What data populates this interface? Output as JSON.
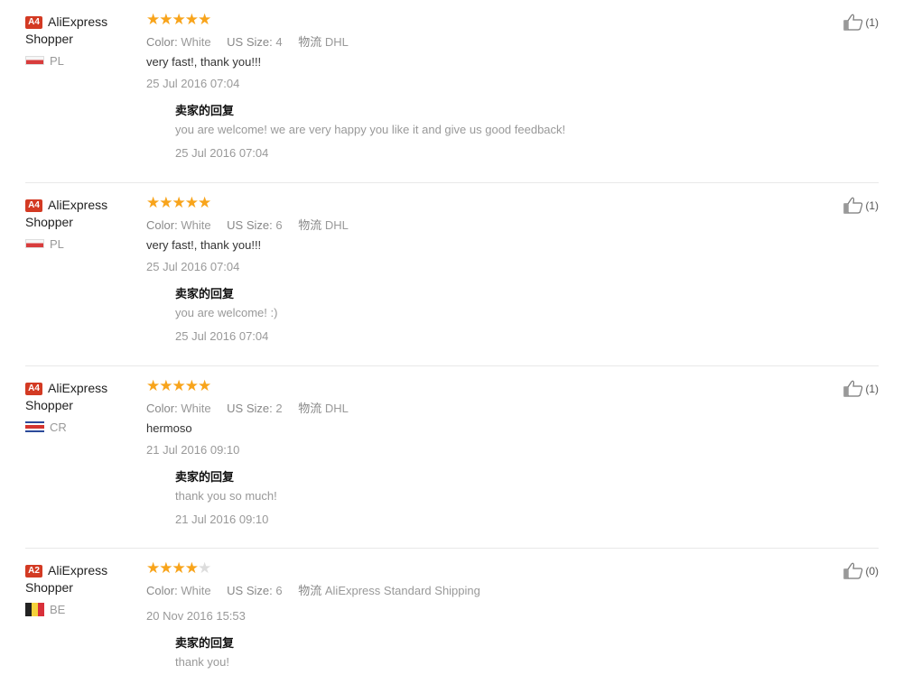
{
  "labels": {
    "color": "Color:",
    "size": "US Size:",
    "shipping": "物流",
    "reply_title": "卖家的回复"
  },
  "colors": {
    "star": "#f8a41b",
    "star_empty": "#dddddd",
    "level_badge": "#d33a23"
  },
  "reviews": [
    {
      "level": "A4",
      "user": "AliExpress Shopper",
      "country": "PL",
      "flag_icon": "flag-poland-icon",
      "rating": 5,
      "color": "White",
      "size": "4",
      "shipping": "DHL",
      "text": "very fast!, thank you!!!",
      "date": "25 Jul 2016 07:04",
      "reply_text": "you are welcome! we are very happy you like it and give us good feedback!",
      "reply_date": "25 Jul 2016 07:04",
      "helpful": "(1)"
    },
    {
      "level": "A4",
      "user": "AliExpress Shopper",
      "country": "PL",
      "flag_icon": "flag-poland-icon",
      "rating": 5,
      "color": "White",
      "size": "6",
      "shipping": "DHL",
      "text": "very fast!, thank you!!!",
      "date": "25 Jul 2016 07:04",
      "reply_text": "you are welcome! :)",
      "reply_date": "25 Jul 2016 07:04",
      "helpful": "(1)"
    },
    {
      "level": "A4",
      "user": "AliExpress Shopper",
      "country": "CR",
      "flag_icon": "flag-costa-rica-icon",
      "rating": 5,
      "color": "White",
      "size": "2",
      "shipping": "DHL",
      "text": "hermoso",
      "date": "21 Jul 2016 09:10",
      "reply_text": "thank you so much!",
      "reply_date": "21 Jul 2016 09:10",
      "helpful": "(1)"
    },
    {
      "level": "A2",
      "user": "AliExpress Shopper",
      "country": "BE",
      "flag_icon": "flag-belgium-icon",
      "rating": 4,
      "color": "White",
      "size": "6",
      "shipping": "AliExpress Standard Shipping",
      "text": "",
      "date": "20 Nov 2016 15:53",
      "reply_text": "thank you!",
      "reply_date": "",
      "helpful": "(0)"
    }
  ]
}
